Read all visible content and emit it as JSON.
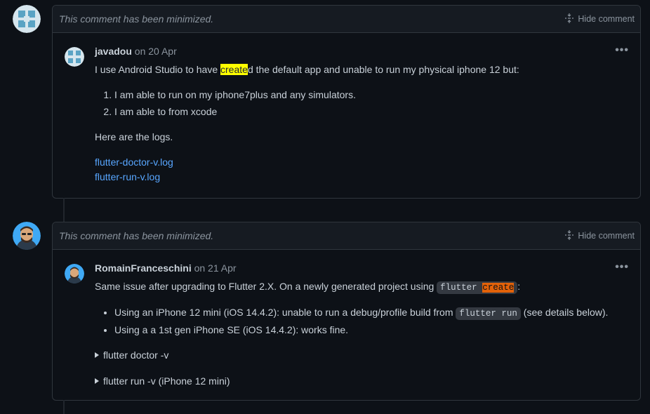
{
  "comments": [
    {
      "minimized_text": "This comment has been minimized.",
      "hide_label": "Hide comment",
      "author": "javadou",
      "date": "on 20 Apr",
      "intro_pre": "I use Android Studio to have ",
      "intro_hl": "create",
      "intro_post": "d the default app and unable to run my physical iphone 12 but:",
      "list_items": [
        "I am able to run on my iphone7plus and any simulators.",
        "I am able to from xcode"
      ],
      "logs_text": "Here are the logs.",
      "links": [
        "flutter-doctor-v.log",
        "flutter-run-v.log"
      ]
    },
    {
      "minimized_text": "This comment has been minimized.",
      "hide_label": "Hide comment",
      "author": "RomainFranceschini",
      "date": "on 21 Apr",
      "intro_pre": "Same issue after upgrading to Flutter 2.X. On a newly generated project using ",
      "code_pre": "flutter ",
      "code_hl": "create",
      "intro_post": ":",
      "bullet1_pre": "Using an iPhone 12 mini (iOS 14.4.2): unable to run a debug/profile build from ",
      "bullet1_code": "flutter run",
      "bullet1_post": " (see details below).",
      "bullet2": "Using a a 1st gen iPhone SE (iOS 14.4.2): works fine.",
      "details": [
        "flutter doctor -v",
        "flutter run -v (iPhone 12 mini)"
      ]
    }
  ],
  "colors": {
    "background": "#0d1117",
    "link": "#58a6ff",
    "highlight_yellow": "#ffff00",
    "highlight_orange": "#e36209"
  }
}
